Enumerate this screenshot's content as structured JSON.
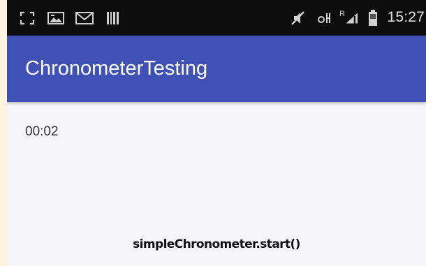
{
  "status_bar": {
    "time": "15:27",
    "icons": [
      "screenshot-icon",
      "image-icon",
      "mail-icon",
      "barcode-icon",
      "mute-icon",
      "wifi-icon",
      "signal-icon",
      "battery-icon"
    ],
    "network_label": "R"
  },
  "app_bar": {
    "title": "ChronometerTesting",
    "color": "#3f51b5"
  },
  "main": {
    "chronometer": "00:02"
  },
  "caption": "simpleChronometer.start()"
}
